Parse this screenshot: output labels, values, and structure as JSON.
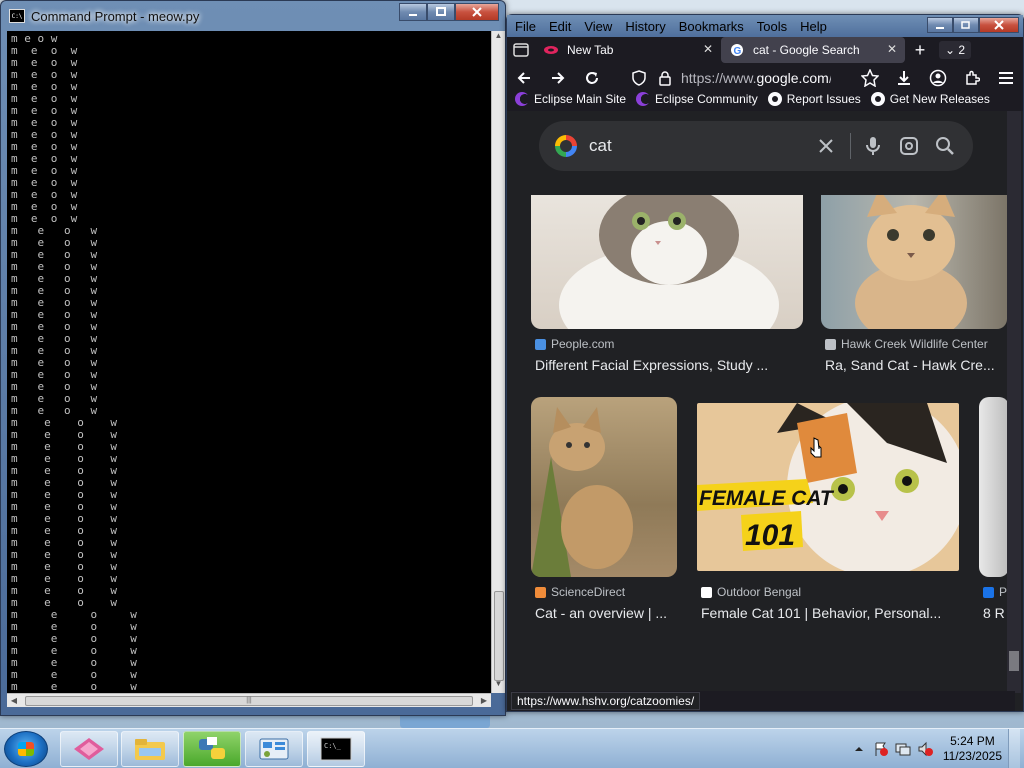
{
  "cmd": {
    "title": "Command Prompt - meow.py",
    "title_icon": "C:\\",
    "output_lines": [
      "m e o w",
      "m  e  o  w",
      "m  e  o  w",
      "m  e  o  w",
      "m  e  o  w",
      "m  e  o  w",
      "m  e  o  w",
      "m  e  o  w",
      "m  e  o  w",
      "m  e  o  w",
      "m  e  o  w",
      "m  e  o  w",
      "m  e  o  w",
      "m  e  o  w",
      "m  e  o  w",
      "m  e  o  w",
      "m   e   o   w",
      "m   e   o   w",
      "m   e   o   w",
      "m   e   o   w",
      "m   e   o   w",
      "m   e   o   w",
      "m   e   o   w",
      "m   e   o   w",
      "m   e   o   w",
      "m   e   o   w",
      "m   e   o   w",
      "m   e   o   w",
      "m   e   o   w",
      "m   e   o   w",
      "m   e   o   w",
      "m   e   o   w",
      "m    e    o    w",
      "m    e    o    w",
      "m    e    o    w",
      "m    e    o    w",
      "m    e    o    w",
      "m    e    o    w",
      "m    e    o    w",
      "m    e    o    w",
      "m    e    o    w",
      "m    e    o    w",
      "m    e    o    w",
      "m    e    o    w",
      "m    e    o    w",
      "m    e    o    w",
      "m    e    o    w",
      "m    e    o    w",
      "m     e     o     w",
      "m     e     o     w",
      "m     e     o     w",
      "m     e     o     w",
      "m     e     o     w",
      "m     e     o     w",
      "m     e     o     w",
      "m     e     o     w"
    ]
  },
  "firefox": {
    "menu": [
      "File",
      "Edit",
      "View",
      "History",
      "Bookmarks",
      "Tools",
      "Help"
    ],
    "tabs": [
      {
        "label": "New Tab",
        "icon": "firefox-icon"
      },
      {
        "label": "cat - Google Search",
        "icon": "google-icon"
      }
    ],
    "tab_count": "2",
    "url_prefix": "https://www.",
    "url_host": "google.com",
    "url_rest": "/",
    "bookmarks": [
      {
        "label": "Eclipse Main Site",
        "icon": "eclipse-icon"
      },
      {
        "label": "Eclipse Community",
        "icon": "eclipse-icon"
      },
      {
        "label": "Report Issues",
        "icon": "github-icon"
      },
      {
        "label": "Get New Releases",
        "icon": "github-icon"
      }
    ],
    "search_query": "cat",
    "results": [
      {
        "source": "People.com",
        "title": "Different Facial Expressions, Study ...",
        "favicon_color": "#4a90e2"
      },
      {
        "source": "Hawk Creek Wildlife Center",
        "title": "Ra, Sand Cat - Hawk Cre...",
        "favicon_color": "#bdc1c6"
      },
      {
        "source": "ScienceDirect",
        "title": "Cat - an overview | ...",
        "favicon_color": "#f08c3a"
      },
      {
        "source": "Outdoor Bengal",
        "title": "Female Cat 101 | Behavior, Personal...",
        "favicon_color": "#ffffff"
      },
      {
        "source": "P",
        "title": "8 R",
        "favicon_color": "#1a73e8"
      }
    ],
    "image_overlay_text_1": "FEMALE CAT",
    "image_overlay_text_2": "101",
    "status_url": "https://www.hshv.org/catzoomies/"
  },
  "taskbar": {
    "time": "5:24 PM",
    "date": "11/23/2025",
    "apps": [
      "app-icon-pink",
      "file-explorer-icon",
      "python-icon",
      "control-panel-icon",
      "command-prompt-icon"
    ]
  }
}
